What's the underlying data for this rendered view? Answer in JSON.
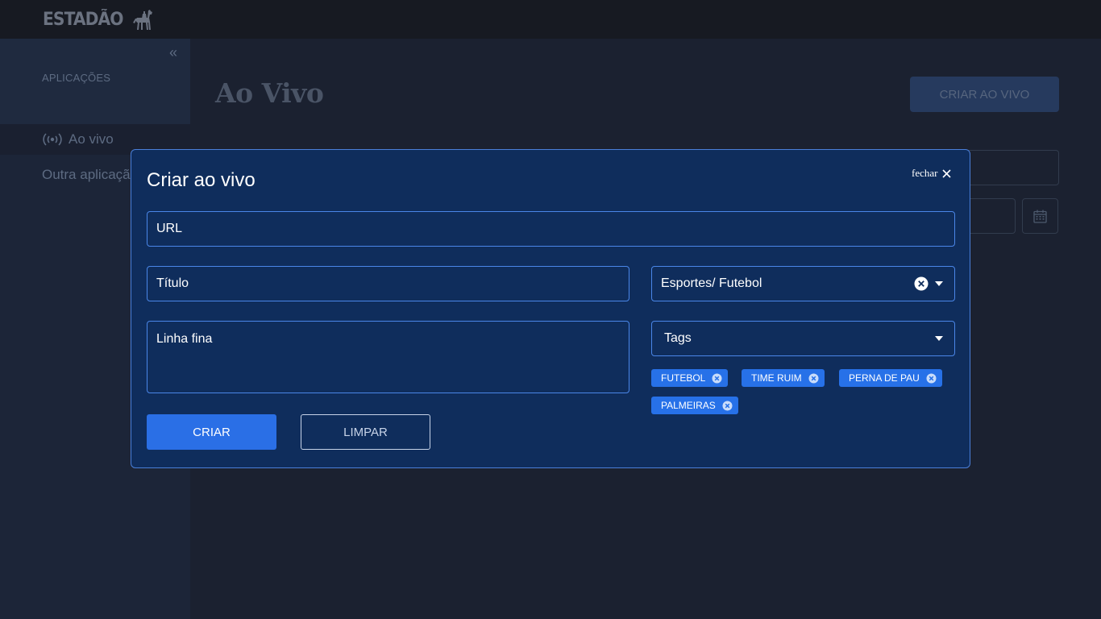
{
  "header": {
    "logo_text": "ESTADÃO",
    "logo_icon": "horse-rider-icon"
  },
  "sidebar": {
    "collapse_icon": "double-chevron-left-icon",
    "collapse_glyph": "«",
    "section_label": "APLICAÇÕES",
    "items": [
      {
        "label": "Ao vivo",
        "icon": "broadcast-icon",
        "active": true
      },
      {
        "label": "Outra aplicação",
        "active": false
      }
    ]
  },
  "main": {
    "title": "Ao Vivo",
    "create_button_label": "CRIAR AO VIVO",
    "calendar_icon": "calendar-icon"
  },
  "modal": {
    "title": "Criar ao vivo",
    "close_label": "fechar",
    "url_placeholder": "URL",
    "title_placeholder": "Título",
    "subtitle_placeholder": "Linha fina",
    "category_value": "Esportes/ Futebol",
    "tags_placeholder": "Tags",
    "tags": [
      {
        "label": "FUTEBOL"
      },
      {
        "label": "TIME RUIM"
      },
      {
        "label": "PERNA DE PAU"
      },
      {
        "label": "PALMEIRAS"
      }
    ],
    "submit_label": "CRIAR",
    "reset_label": "LIMPAR"
  },
  "colors": {
    "page_background": "#1b2130",
    "modal_background": "#0f2d5c",
    "accent": "#2a6fe6",
    "field_border": "#4a86e8"
  }
}
